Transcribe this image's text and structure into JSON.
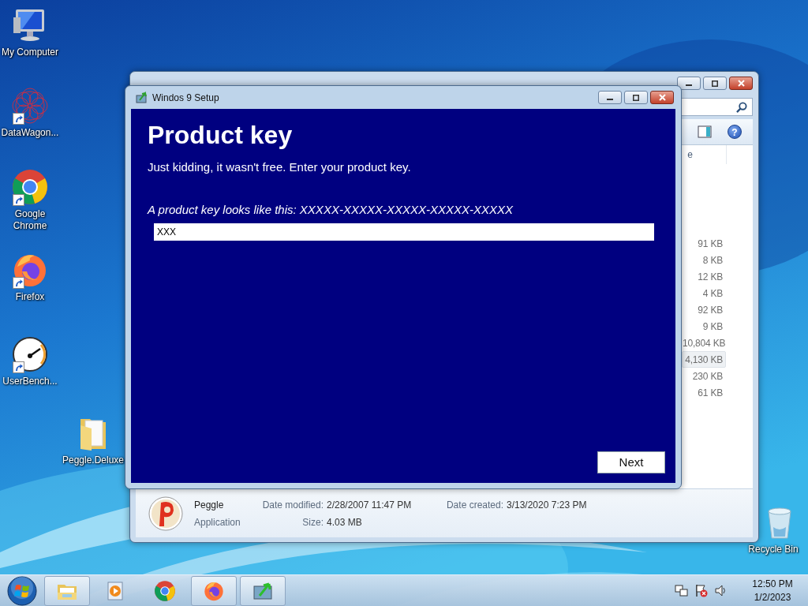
{
  "desktop_icons": [
    {
      "kind": "computer",
      "label": "My Computer",
      "shortcut": false
    },
    {
      "kind": "star-mesh",
      "label": "DataWagon...",
      "shortcut": true
    },
    {
      "kind": "chrome",
      "label": "Google Chrome",
      "shortcut": true
    },
    {
      "kind": "firefox",
      "label": "Firefox",
      "shortcut": true
    },
    {
      "kind": "gauge",
      "label": "UserBench...",
      "shortcut": true
    },
    {
      "kind": "folder",
      "label": "Peggle.Deluxe",
      "shortcut": false
    },
    {
      "kind": "recycle-bin",
      "label": "Recycle Bin",
      "shortcut": false
    }
  ],
  "explorer": {
    "column_header": "e",
    "help_label": "?",
    "files": [
      {
        "size": "91 KB",
        "selected": false
      },
      {
        "size": "8 KB",
        "selected": false
      },
      {
        "size": "12 KB",
        "selected": false
      },
      {
        "size": "4 KB",
        "selected": false
      },
      {
        "size": "92 KB",
        "selected": false
      },
      {
        "size": "9 KB",
        "selected": false
      },
      {
        "size": "10,804 KB",
        "selected": false
      },
      {
        "size": "4,130 KB",
        "selected": true
      },
      {
        "size": "230 KB",
        "selected": false
      },
      {
        "size": "61 KB",
        "selected": false
      }
    ],
    "details": {
      "name": "Peggle",
      "type": "Application",
      "fields": [
        {
          "label": "Date modified:",
          "value": "2/28/2007 11:47 PM"
        },
        {
          "label": "Size:",
          "value": "4.03 MB"
        },
        {
          "label": "Date created:",
          "value": "3/13/2020 7:23 PM"
        }
      ]
    }
  },
  "setup": {
    "title": "Windos 9 Setup",
    "heading": "Product key",
    "subtitle": "Just kidding, it wasn't free. Enter your product key.",
    "hint": "A product key looks like this: XXXXX-XXXXX-XXXXX-XXXXX-XXXXX",
    "key_value": "XXX",
    "next_button": "Next"
  },
  "taskbar": {
    "items": [
      {
        "kind": "explorer",
        "running": true
      },
      {
        "kind": "media",
        "running": false
      },
      {
        "kind": "chrome",
        "running": false
      },
      {
        "kind": "firefox",
        "running": true
      },
      {
        "kind": "setup",
        "running": true
      }
    ],
    "clock": {
      "time": "12:50 PM",
      "date": "1/2/2023"
    }
  }
}
